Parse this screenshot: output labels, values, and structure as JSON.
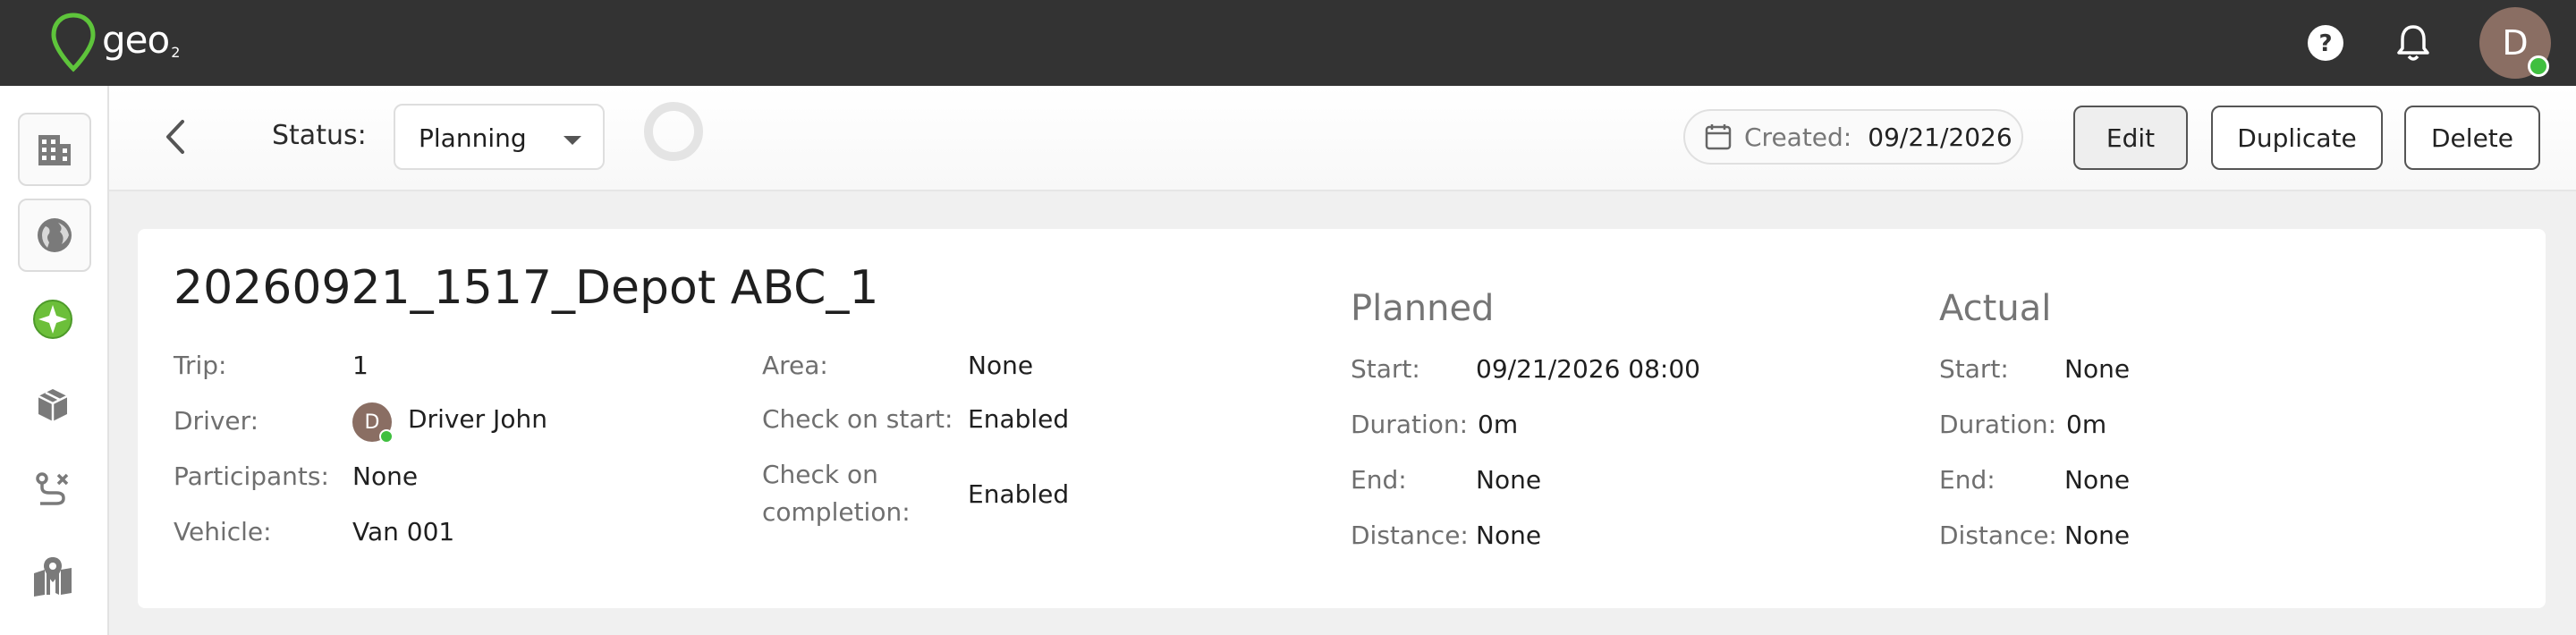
{
  "app": {
    "logo_text": "geo",
    "logo_sub": "2",
    "user_initial": "D"
  },
  "toolbar": {
    "status_label": "Status:",
    "status_value": "Planning",
    "created_label": "Created:",
    "created_value": "09/21/2026",
    "edit_label": "Edit",
    "duplicate_label": "Duplicate",
    "delete_label": "Delete"
  },
  "sidebar": {
    "items": [
      {
        "icon": "building-icon"
      },
      {
        "icon": "globe-icon"
      },
      {
        "icon": "sparkle-globe-icon"
      },
      {
        "icon": "package-icon"
      },
      {
        "icon": "route-icon"
      },
      {
        "icon": "map-icon"
      }
    ]
  },
  "trip": {
    "title": "20260921_1517_Depot ABC_1",
    "fields": {
      "trip_label": "Trip:",
      "trip_value": "1",
      "driver_label": "Driver:",
      "driver_initial": "D",
      "driver_value": "Driver John",
      "participants_label": "Participants:",
      "participants_value": "None",
      "vehicle_label": "Vehicle:",
      "vehicle_value": "Van 001",
      "area_label": "Area:",
      "area_value": "None",
      "check_start_label": "Check on start:",
      "check_start_value": "Enabled",
      "check_completion_label_1": "Check on",
      "check_completion_label_2": "completion:",
      "check_completion_value": "Enabled"
    },
    "planned": {
      "title": "Planned",
      "start_label": "Start:",
      "start_value": "09/21/2026 08:00",
      "duration_label": "Duration:",
      "duration_value": "0m",
      "end_label": "End:",
      "end_value": "None",
      "distance_label": "Distance:",
      "distance_value": "None"
    },
    "actual": {
      "title": "Actual",
      "start_label": "Start:",
      "start_value": "None",
      "duration_label": "Duration:",
      "duration_value": "0m",
      "end_label": "End:",
      "end_value": "None",
      "distance_label": "Distance:",
      "distance_value": "None"
    }
  },
  "colors": {
    "topbar": "#333333",
    "accent_green": "#5ec43b",
    "avatar": "#8a6e63",
    "online": "#3fbf3f"
  }
}
